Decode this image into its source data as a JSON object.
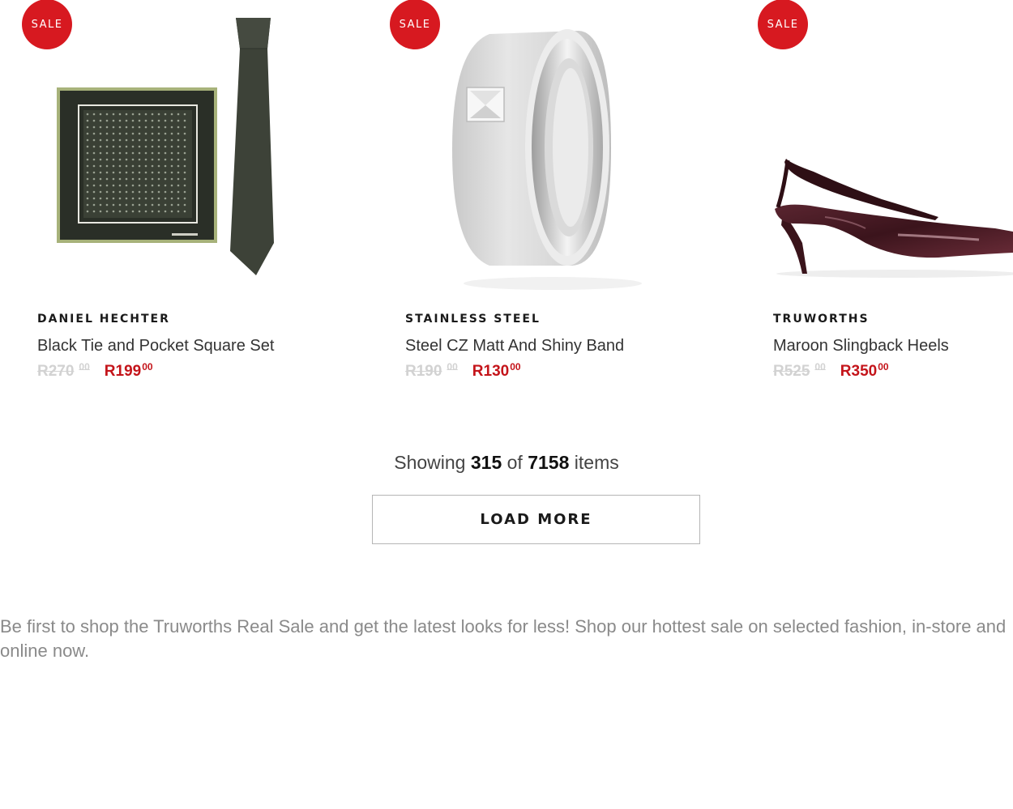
{
  "products": [
    {
      "badge": "SALE",
      "brand": "DANIEL HECHTER",
      "name": "Black Tie and Pocket Square Set",
      "was_price": "R270",
      "was_cents": "00",
      "now_price": "R199",
      "now_cents": "00"
    },
    {
      "badge": "SALE",
      "brand": "STAINLESS STEEL",
      "name": "Steel CZ Matt And Shiny Band",
      "was_price": "R190",
      "was_cents": "00",
      "now_price": "R130",
      "now_cents": "00"
    },
    {
      "badge": "SALE",
      "brand": "TRUWORTHS",
      "name": "Maroon Slingback Heels",
      "was_price": "R525",
      "was_cents": "00",
      "now_price": "R350",
      "now_cents": "00"
    }
  ],
  "pagination": {
    "showing_prefix": "Showing",
    "shown_count": "315",
    "of_word": "of",
    "total_count": "7158",
    "items_word": "items",
    "load_more_label": "LOAD MORE"
  },
  "footer": {
    "description": "Be first to shop the Truworths Real Sale and get the latest looks for less! Shop our hottest sale on selected fashion, in-store and online now."
  },
  "colors": {
    "sale_badge": "#d71920",
    "sale_price": "#c4141a",
    "was_price": "#d2d2d2"
  }
}
